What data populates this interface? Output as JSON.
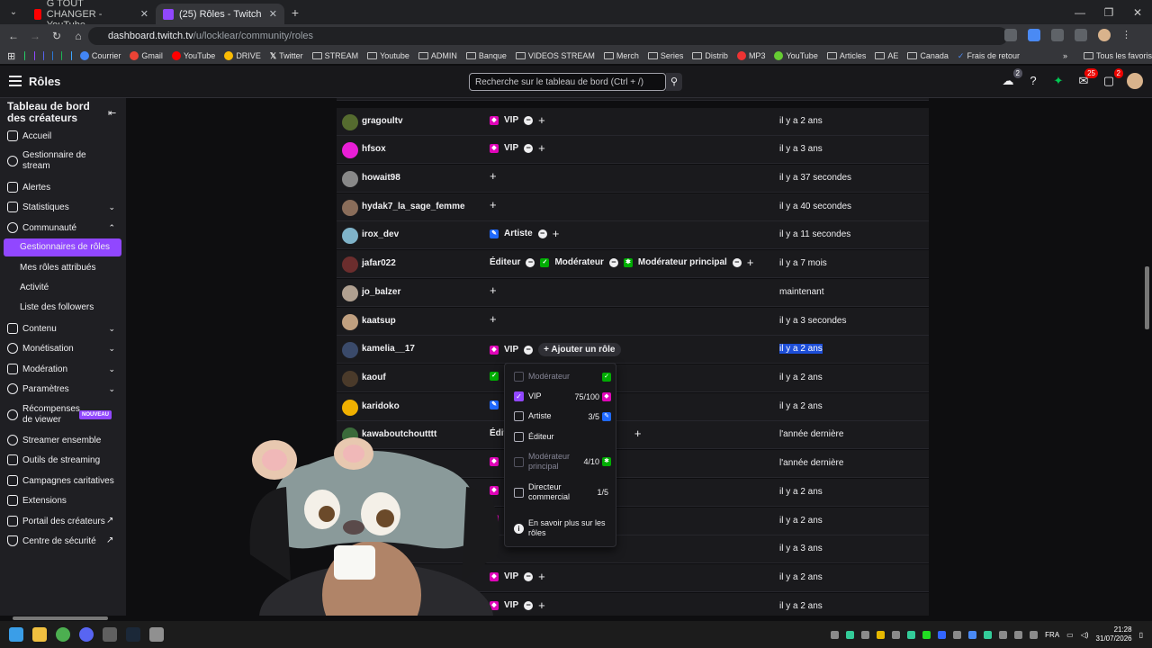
{
  "browser": {
    "tabs": [
      {
        "title": "G TOUT CHANGER - YouTube",
        "color": "#ff0000"
      },
      {
        "title": "(25) Rôles - Twitch",
        "color": "#9147ff"
      }
    ],
    "url_host": "dashboard.twitch.tv",
    "url_path": "/u/locklear/community/roles",
    "bookmarks": [
      "Courrier",
      "Gmail",
      "YouTube",
      "DRIVE",
      "Twitter",
      "STREAM",
      "Youtube",
      "ADMIN",
      "Banque",
      "VIDEOS STREAM",
      "Merch",
      "Series",
      "Distrib",
      "MP3",
      "YouTube",
      "Articles",
      "AE",
      "Canada",
      "Frais de retour"
    ],
    "all_favorites": "Tous les favoris"
  },
  "topnav": {
    "title": "Rôles",
    "search_placeholder": "Recherche sur le tableau de bord (Ctrl + /)",
    "badge_1": "2",
    "badge_2": "25",
    "badge_3": "2"
  },
  "sidebar": {
    "header": "Tableau de bord des créateurs",
    "items": [
      {
        "label": "Accueil"
      },
      {
        "label": "Gestionnaire de stream"
      },
      {
        "label": "Alertes"
      },
      {
        "label": "Statistiques"
      },
      {
        "label": "Communauté"
      },
      {
        "label": "Gestionnaires de rôles"
      },
      {
        "label": "Mes rôles attribués"
      },
      {
        "label": "Activité"
      },
      {
        "label": "Liste des followers"
      },
      {
        "label": "Contenu"
      },
      {
        "label": "Monétisation"
      },
      {
        "label": "Modération"
      },
      {
        "label": "Paramètres"
      },
      {
        "label": "Récompenses de viewer"
      },
      {
        "label": "Streamer ensemble"
      },
      {
        "label": "Outils de streaming"
      },
      {
        "label": "Campagnes caritatives"
      },
      {
        "label": "Extensions"
      },
      {
        "label": "Portail des créateurs"
      },
      {
        "label": "Centre de sécurité"
      }
    ],
    "new_badge": "NOUVEAU"
  },
  "roles_table": {
    "rows": [
      {
        "user": "gragoultv",
        "roles": [
          "VIP"
        ],
        "date": "il y a 2 ans",
        "avatar": "#556b2f"
      },
      {
        "user": "hfsox",
        "roles": [
          "VIP"
        ],
        "date": "il y a 3 ans",
        "avatar": "#e91ed6"
      },
      {
        "user": "howait98",
        "roles": [],
        "date": "il y a 37 secondes",
        "avatar": "#888888"
      },
      {
        "user": "hydak7_la_sage_femme",
        "roles": [],
        "date": "il y a 40 secondes",
        "avatar": "#8a6d5a"
      },
      {
        "user": "irox_dev",
        "roles": [
          "Artiste"
        ],
        "date": "il y a 11 secondes",
        "avatar": "#7fb3c9"
      },
      {
        "user": "jafar022",
        "roles": [
          "Éditeur",
          "Modérateur",
          "Modérateur principal"
        ],
        "date": "il y a 7 mois",
        "avatar": "#6b2d2d"
      },
      {
        "user": "jo_balzer",
        "roles": [],
        "date": "maintenant",
        "avatar": "#b0a090"
      },
      {
        "user": "kaatsup",
        "roles": [],
        "date": "il y a 3 secondes",
        "avatar": "#c0a080"
      },
      {
        "user": "kamelia__17",
        "roles": [
          "VIP"
        ],
        "date": "il y a 2 ans",
        "avatar": "#3a4a6a"
      },
      {
        "user": "kaouf",
        "roles": [],
        "date": "il y a 2 ans",
        "avatar": "#4a3a2a"
      },
      {
        "user": "karidoko",
        "roles": [],
        "date": "il y a 2 ans",
        "avatar": "#f0b000"
      },
      {
        "user": "kawaboutchoutttt",
        "roles": [],
        "date": "l'année dernière",
        "avatar": "#3a6a3a"
      },
      {
        "user": "",
        "roles": [],
        "date": "l'année dernière",
        "avatar": "#333333"
      },
      {
        "user": "",
        "roles": [],
        "date": "il y a 2 ans",
        "avatar": "#333333"
      },
      {
        "user": "",
        "roles": [],
        "date": "il y a 2 ans",
        "avatar": "#333333"
      },
      {
        "user": "",
        "roles": [],
        "date": "il y a 3 ans",
        "avatar": "#333333"
      },
      {
        "user": "",
        "roles": [
          "VIP"
        ],
        "date": "il y a 2 ans",
        "avatar": "#333333"
      },
      {
        "user": "",
        "roles": [
          "VIP"
        ],
        "date": "il y a 2 ans",
        "avatar": "#333333"
      }
    ],
    "add_role_label": "Ajouter un rôle",
    "partial_role_a": "É",
    "partial_role_b": "Édit"
  },
  "role_dropdown": {
    "options": [
      {
        "label": "Modérateur",
        "count": "",
        "checked": false,
        "disabled": true
      },
      {
        "label": "VIP",
        "count": "75/100",
        "checked": true,
        "disabled": false
      },
      {
        "label": "Artiste",
        "count": "3/5",
        "checked": false,
        "disabled": false
      },
      {
        "label": "Éditeur",
        "count": "",
        "checked": false,
        "disabled": false
      },
      {
        "label": "Modérateur principal",
        "count": "4/10",
        "checked": false,
        "disabled": true
      },
      {
        "label": "Directeur commercial",
        "count": "1/5",
        "checked": false,
        "disabled": false
      }
    ],
    "learn_more": "En savoir plus sur les rôles"
  },
  "taskbar": {
    "lang": "FRA",
    "time": "21:28",
    "date": "31/07/2026"
  },
  "colors": {
    "accent": "#9147ff",
    "vip": "#e005b9",
    "artist": "#1f69ff",
    "mod": "#00ad03",
    "highlight": "#1d4ed8"
  }
}
